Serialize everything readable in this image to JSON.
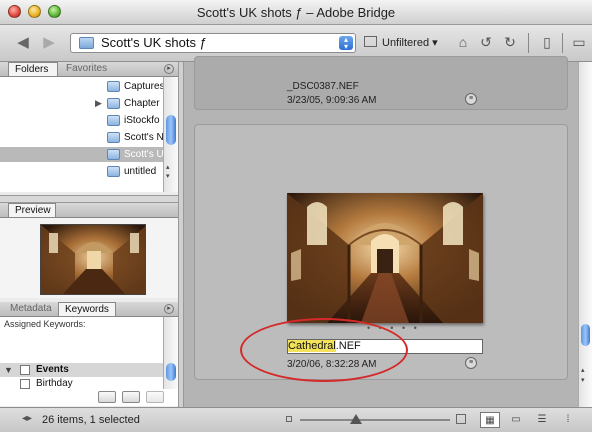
{
  "window": {
    "title": "Scott's UK shots ƒ – Adobe Bridge"
  },
  "toolbar": {
    "back_icon": "back-arrow-icon",
    "forward_icon": "forward-arrow-icon",
    "path_label": "Scott's UK shots ƒ",
    "filter_label": "Unfiltered ▾",
    "filter_caret": "▾"
  },
  "left_panel": {
    "tabs_top": {
      "folders": "Folders",
      "favorites": "Favorites"
    },
    "folders": [
      {
        "label": "Captures"
      },
      {
        "label": "Chapter"
      },
      {
        "label": "iStockfo"
      },
      {
        "label": "Scott's N"
      },
      {
        "label": "Scott's U"
      },
      {
        "label": "untitled"
      }
    ],
    "preview_tab": "Preview",
    "tabs_bottom": {
      "metadata": "Metadata",
      "keywords": "Keywords"
    },
    "keywords": {
      "assigned_label": "Assigned Keywords:",
      "group": "Events",
      "items": [
        "Birthday"
      ]
    }
  },
  "content": {
    "items": [
      {
        "filename": "_DSC0387.NEF",
        "date": "3/23/05, 9:09:36 AM"
      },
      {
        "filename_highlight": "Cathedral",
        "filename_rest": ".NEF",
        "date": "3/20/06, 8:32:28 AM",
        "dots": "• • • • •"
      }
    ]
  },
  "status": {
    "text": "26 items, 1 selected"
  },
  "colors": {
    "annotation": "#d42a2a",
    "selection_accent": "#3d7bd5",
    "rename_highlight": "#f3e25a"
  }
}
